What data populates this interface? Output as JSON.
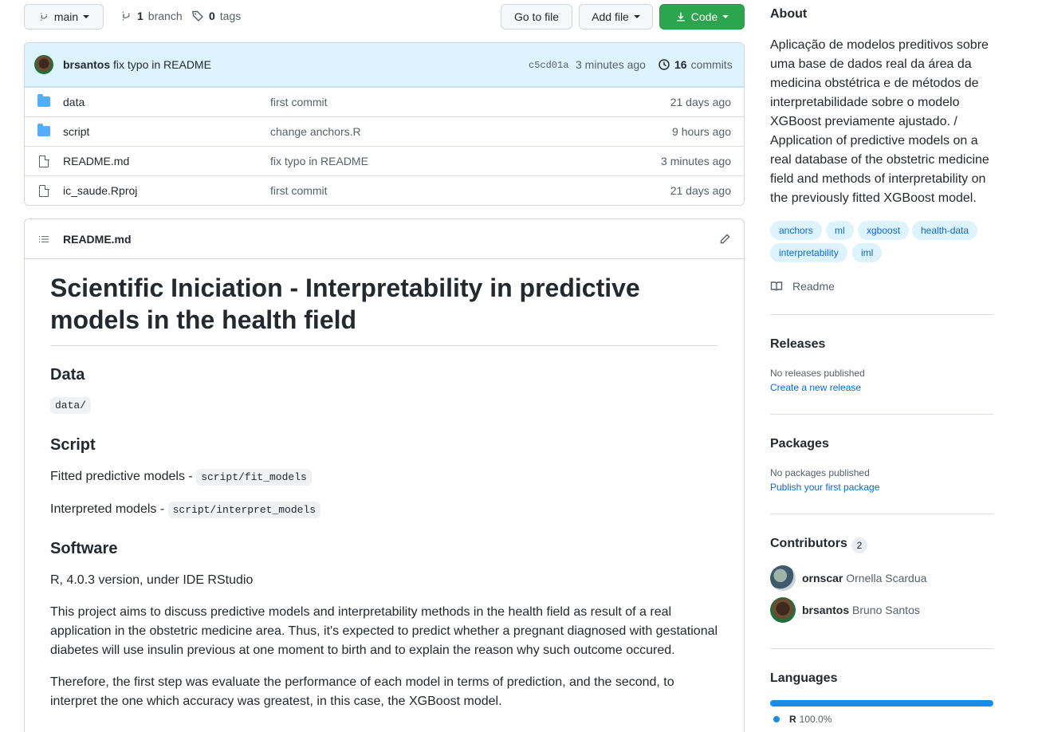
{
  "toolbar": {
    "branch_label": "main",
    "branches_count": "1",
    "branches_label": "branch",
    "tags_count": "0",
    "tags_label": "tags",
    "go_to_file": "Go to file",
    "add_file": "Add file",
    "code": "Code"
  },
  "commit": {
    "author": "brsantos",
    "message": "fix typo in README",
    "sha": "c5cd01a",
    "time": "3 minutes ago",
    "commits_count": "16",
    "commits_label": "commits"
  },
  "files": [
    {
      "name": "data",
      "type": "folder",
      "message": "first commit",
      "age": "21 days ago"
    },
    {
      "name": "script",
      "type": "folder",
      "message": "change anchors.R",
      "age": "9 hours ago"
    },
    {
      "name": "README.md",
      "type": "file",
      "message": "fix typo in README",
      "age": "3 minutes ago"
    },
    {
      "name": "ic_saude.Rproj",
      "type": "file",
      "message": "first commit",
      "age": "21 days ago"
    }
  ],
  "readme": {
    "filename": "README.md",
    "title": "Scientific Iniciation - Interpretability in predictive models in the health field",
    "data_heading": "Data",
    "data_code": "data/",
    "script_heading": "Script",
    "fitted_label": "Fitted predictive models - ",
    "fitted_code": "script/fit_models",
    "interpreted_label": "Interpreted models - ",
    "interpreted_code": "script/interpret_models",
    "software_heading": "Software",
    "software_text": "R, 4.0.3 version, under IDE RStudio",
    "para1": "This project aims to discuss predictive models and interpretability methods in the health field as result of a real application in the obstetric medicine area. Thus, it's expected to predict whether a pregnant diagnosed with gestational diabetes will use insulin previous at one moment to birth and to explain the reason why such outcome occured.",
    "para2": "Therefore, the first step was evaluate the performance of each model in terms of prediction, and the second, to interpret the one which accuracy was greatest, in this case, the XGBoost model."
  },
  "about": {
    "heading": "About",
    "description": "Aplicação de modelos preditivos sobre uma base de dados real da área da medicina obstétrica e de métodos de interpretabilidade sobre o modelo XGBoost previamente ajustado. / Application of predictive models on a real database of the obstetric medicine field and methods of interpretability on the previously fitted XGBoost model.",
    "topics": [
      "anchors",
      "ml",
      "xgboost",
      "health-data",
      "interpretability",
      "iml"
    ],
    "readme_link": "Readme"
  },
  "releases": {
    "heading": "Releases",
    "status": "No releases published",
    "link": "Create a new release"
  },
  "packages": {
    "heading": "Packages",
    "status": "No packages published",
    "link": "Publish your first package"
  },
  "contributors": {
    "heading": "Contributors",
    "count": "2",
    "list": [
      {
        "login": "ornscar",
        "name": "Ornella Scardua"
      },
      {
        "login": "brsantos",
        "name": "Bruno Santos"
      }
    ]
  },
  "languages": {
    "heading": "Languages",
    "items": [
      {
        "name": "R",
        "percent": "100.0%",
        "share": 100,
        "color": "#198ce7"
      }
    ]
  }
}
